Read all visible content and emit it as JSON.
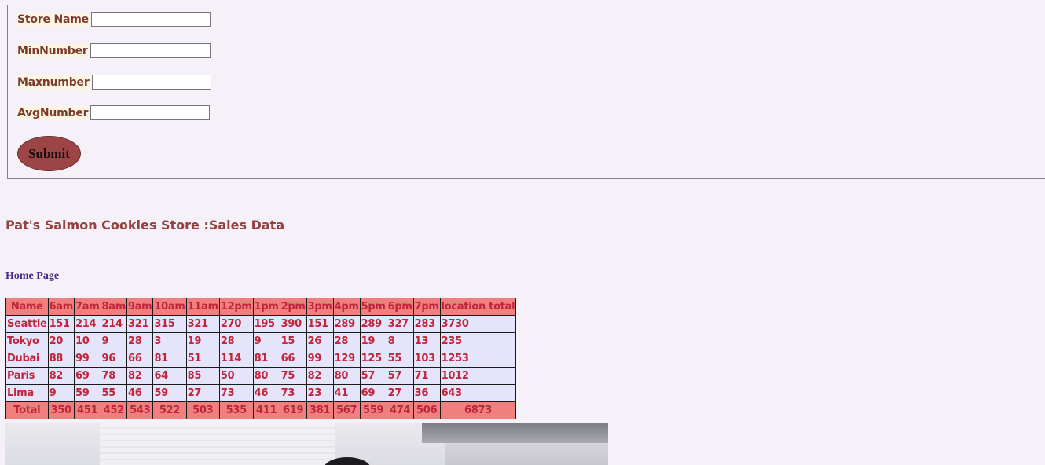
{
  "form": {
    "fields": [
      {
        "label": "Store Name",
        "value": "",
        "placeholder": ""
      },
      {
        "label": "MinNumber",
        "value": "",
        "placeholder": ""
      },
      {
        "label": "Maxnumber",
        "value": "",
        "placeholder": ""
      },
      {
        "label": "AvgNumber",
        "value": "",
        "placeholder": ""
      }
    ],
    "submit_label": "Submit"
  },
  "page_title": "Pat's Salmon Cookies Store :Sales Data",
  "home_link": "Home Page",
  "table": {
    "headers": [
      "Name",
      "6am",
      "7am",
      "8am",
      "9am",
      "10am",
      "11am",
      "12pm",
      "1pm",
      "2pm",
      "3pm",
      "4pm",
      "5pm",
      "6pm",
      "7pm",
      "location total"
    ],
    "rows": [
      [
        "Seattle",
        "151",
        "214",
        "214",
        "321",
        "315",
        "321",
        "270",
        "195",
        "390",
        "151",
        "289",
        "289",
        "327",
        "283",
        "3730"
      ],
      [
        "Tokyo",
        "20",
        "10",
        "9",
        "28",
        "3",
        "19",
        "28",
        "9",
        "15",
        "26",
        "28",
        "19",
        "8",
        "13",
        "235"
      ],
      [
        "Dubai",
        "88",
        "99",
        "96",
        "66",
        "81",
        "51",
        "114",
        "81",
        "66",
        "99",
        "129",
        "125",
        "55",
        "103",
        "1253"
      ],
      [
        "Paris",
        "82",
        "69",
        "78",
        "82",
        "64",
        "85",
        "50",
        "80",
        "75",
        "82",
        "80",
        "57",
        "57",
        "71",
        "1012"
      ],
      [
        "Lima",
        "9",
        "59",
        "55",
        "46",
        "59",
        "27",
        "73",
        "46",
        "73",
        "23",
        "41",
        "69",
        "27",
        "36",
        "643"
      ]
    ],
    "totals": [
      "Total",
      "350",
      "451",
      "452",
      "543",
      "522",
      "503",
      "535",
      "411",
      "619",
      "381",
      "567",
      "559",
      "474",
      "506",
      "6873"
    ]
  },
  "colors": {
    "header_bg": "#f07f7d",
    "row_bg": "#e4e4fa",
    "text": "#c0253b",
    "button": "#9d4447"
  }
}
